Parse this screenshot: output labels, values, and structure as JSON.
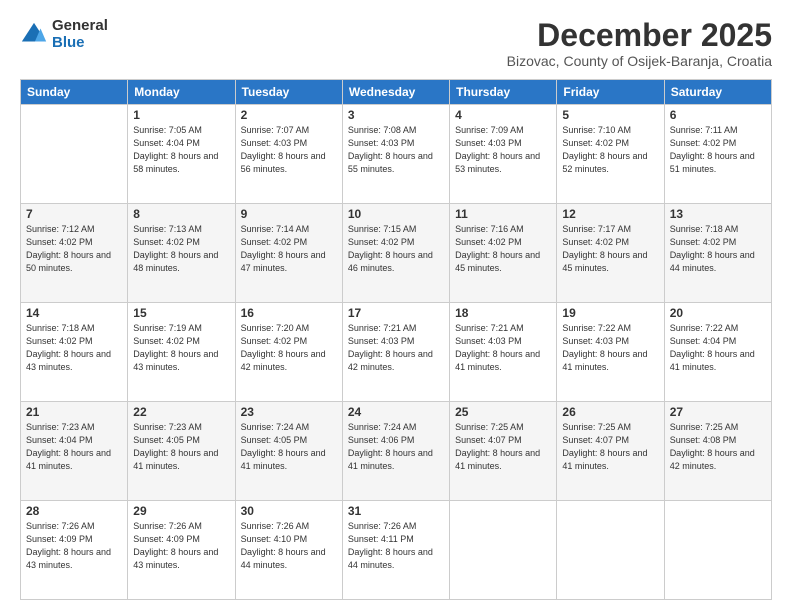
{
  "logo": {
    "general": "General",
    "blue": "Blue"
  },
  "header": {
    "month": "December 2025",
    "location": "Bizovac, County of Osijek-Baranja, Croatia"
  },
  "weekdays": [
    "Sunday",
    "Monday",
    "Tuesday",
    "Wednesday",
    "Thursday",
    "Friday",
    "Saturday"
  ],
  "weeks": [
    [
      {
        "day": "",
        "sunrise": "",
        "sunset": "",
        "daylight": ""
      },
      {
        "day": "1",
        "sunrise": "Sunrise: 7:05 AM",
        "sunset": "Sunset: 4:04 PM",
        "daylight": "Daylight: 8 hours and 58 minutes."
      },
      {
        "day": "2",
        "sunrise": "Sunrise: 7:07 AM",
        "sunset": "Sunset: 4:03 PM",
        "daylight": "Daylight: 8 hours and 56 minutes."
      },
      {
        "day": "3",
        "sunrise": "Sunrise: 7:08 AM",
        "sunset": "Sunset: 4:03 PM",
        "daylight": "Daylight: 8 hours and 55 minutes."
      },
      {
        "day": "4",
        "sunrise": "Sunrise: 7:09 AM",
        "sunset": "Sunset: 4:03 PM",
        "daylight": "Daylight: 8 hours and 53 minutes."
      },
      {
        "day": "5",
        "sunrise": "Sunrise: 7:10 AM",
        "sunset": "Sunset: 4:02 PM",
        "daylight": "Daylight: 8 hours and 52 minutes."
      },
      {
        "day": "6",
        "sunrise": "Sunrise: 7:11 AM",
        "sunset": "Sunset: 4:02 PM",
        "daylight": "Daylight: 8 hours and 51 minutes."
      }
    ],
    [
      {
        "day": "7",
        "sunrise": "Sunrise: 7:12 AM",
        "sunset": "Sunset: 4:02 PM",
        "daylight": "Daylight: 8 hours and 50 minutes."
      },
      {
        "day": "8",
        "sunrise": "Sunrise: 7:13 AM",
        "sunset": "Sunset: 4:02 PM",
        "daylight": "Daylight: 8 hours and 48 minutes."
      },
      {
        "day": "9",
        "sunrise": "Sunrise: 7:14 AM",
        "sunset": "Sunset: 4:02 PM",
        "daylight": "Daylight: 8 hours and 47 minutes."
      },
      {
        "day": "10",
        "sunrise": "Sunrise: 7:15 AM",
        "sunset": "Sunset: 4:02 PM",
        "daylight": "Daylight: 8 hours and 46 minutes."
      },
      {
        "day": "11",
        "sunrise": "Sunrise: 7:16 AM",
        "sunset": "Sunset: 4:02 PM",
        "daylight": "Daylight: 8 hours and 45 minutes."
      },
      {
        "day": "12",
        "sunrise": "Sunrise: 7:17 AM",
        "sunset": "Sunset: 4:02 PM",
        "daylight": "Daylight: 8 hours and 45 minutes."
      },
      {
        "day": "13",
        "sunrise": "Sunrise: 7:18 AM",
        "sunset": "Sunset: 4:02 PM",
        "daylight": "Daylight: 8 hours and 44 minutes."
      }
    ],
    [
      {
        "day": "14",
        "sunrise": "Sunrise: 7:18 AM",
        "sunset": "Sunset: 4:02 PM",
        "daylight": "Daylight: 8 hours and 43 minutes."
      },
      {
        "day": "15",
        "sunrise": "Sunrise: 7:19 AM",
        "sunset": "Sunset: 4:02 PM",
        "daylight": "Daylight: 8 hours and 43 minutes."
      },
      {
        "day": "16",
        "sunrise": "Sunrise: 7:20 AM",
        "sunset": "Sunset: 4:02 PM",
        "daylight": "Daylight: 8 hours and 42 minutes."
      },
      {
        "day": "17",
        "sunrise": "Sunrise: 7:21 AM",
        "sunset": "Sunset: 4:03 PM",
        "daylight": "Daylight: 8 hours and 42 minutes."
      },
      {
        "day": "18",
        "sunrise": "Sunrise: 7:21 AM",
        "sunset": "Sunset: 4:03 PM",
        "daylight": "Daylight: 8 hours and 41 minutes."
      },
      {
        "day": "19",
        "sunrise": "Sunrise: 7:22 AM",
        "sunset": "Sunset: 4:03 PM",
        "daylight": "Daylight: 8 hours and 41 minutes."
      },
      {
        "day": "20",
        "sunrise": "Sunrise: 7:22 AM",
        "sunset": "Sunset: 4:04 PM",
        "daylight": "Daylight: 8 hours and 41 minutes."
      }
    ],
    [
      {
        "day": "21",
        "sunrise": "Sunrise: 7:23 AM",
        "sunset": "Sunset: 4:04 PM",
        "daylight": "Daylight: 8 hours and 41 minutes."
      },
      {
        "day": "22",
        "sunrise": "Sunrise: 7:23 AM",
        "sunset": "Sunset: 4:05 PM",
        "daylight": "Daylight: 8 hours and 41 minutes."
      },
      {
        "day": "23",
        "sunrise": "Sunrise: 7:24 AM",
        "sunset": "Sunset: 4:05 PM",
        "daylight": "Daylight: 8 hours and 41 minutes."
      },
      {
        "day": "24",
        "sunrise": "Sunrise: 7:24 AM",
        "sunset": "Sunset: 4:06 PM",
        "daylight": "Daylight: 8 hours and 41 minutes."
      },
      {
        "day": "25",
        "sunrise": "Sunrise: 7:25 AM",
        "sunset": "Sunset: 4:07 PM",
        "daylight": "Daylight: 8 hours and 41 minutes."
      },
      {
        "day": "26",
        "sunrise": "Sunrise: 7:25 AM",
        "sunset": "Sunset: 4:07 PM",
        "daylight": "Daylight: 8 hours and 41 minutes."
      },
      {
        "day": "27",
        "sunrise": "Sunrise: 7:25 AM",
        "sunset": "Sunset: 4:08 PM",
        "daylight": "Daylight: 8 hours and 42 minutes."
      }
    ],
    [
      {
        "day": "28",
        "sunrise": "Sunrise: 7:26 AM",
        "sunset": "Sunset: 4:09 PM",
        "daylight": "Daylight: 8 hours and 43 minutes."
      },
      {
        "day": "29",
        "sunrise": "Sunrise: 7:26 AM",
        "sunset": "Sunset: 4:09 PM",
        "daylight": "Daylight: 8 hours and 43 minutes."
      },
      {
        "day": "30",
        "sunrise": "Sunrise: 7:26 AM",
        "sunset": "Sunset: 4:10 PM",
        "daylight": "Daylight: 8 hours and 44 minutes."
      },
      {
        "day": "31",
        "sunrise": "Sunrise: 7:26 AM",
        "sunset": "Sunset: 4:11 PM",
        "daylight": "Daylight: 8 hours and 44 minutes."
      },
      {
        "day": "",
        "sunrise": "",
        "sunset": "",
        "daylight": ""
      },
      {
        "day": "",
        "sunrise": "",
        "sunset": "",
        "daylight": ""
      },
      {
        "day": "",
        "sunrise": "",
        "sunset": "",
        "daylight": ""
      }
    ]
  ]
}
